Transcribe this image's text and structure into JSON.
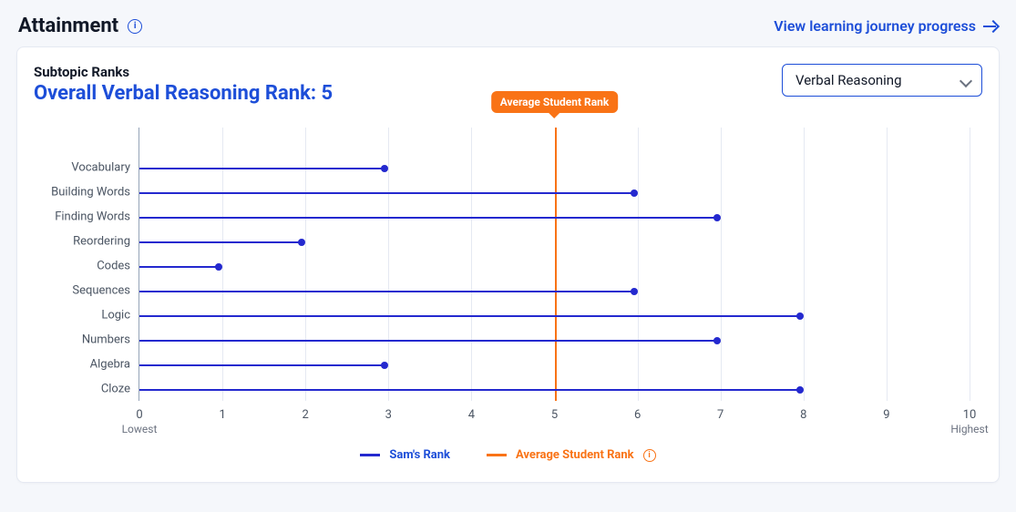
{
  "header": {
    "title": "Attainment",
    "info_glyph": "i",
    "view_link": "View learning journey progress"
  },
  "card": {
    "sub_label": "Subtopic Ranks",
    "overall_title": "Overall Verbal Reasoning Rank: 5",
    "selector_value": "Verbal Reasoning"
  },
  "chart_data": {
    "type": "bar",
    "orientation": "horizontal",
    "categories": [
      "Vocabulary",
      "Building Words",
      "Finding Words",
      "Reordering",
      "Codes",
      "Sequences",
      "Logic",
      "Numbers",
      "Algebra",
      "Cloze"
    ],
    "values": [
      3,
      6,
      7,
      2,
      1,
      6,
      8,
      7,
      3,
      8
    ],
    "xlabel_low": "Lowest",
    "xlabel_high": "Highest",
    "xlim": [
      0,
      10
    ],
    "ticks": [
      0,
      1,
      2,
      3,
      4,
      5,
      6,
      7,
      8,
      9,
      10
    ],
    "reference_line": {
      "label": "Average Student Rank",
      "value": 5
    },
    "legend": {
      "series_label": "Sam's Rank",
      "avg_label": "Average Student Rank"
    }
  }
}
